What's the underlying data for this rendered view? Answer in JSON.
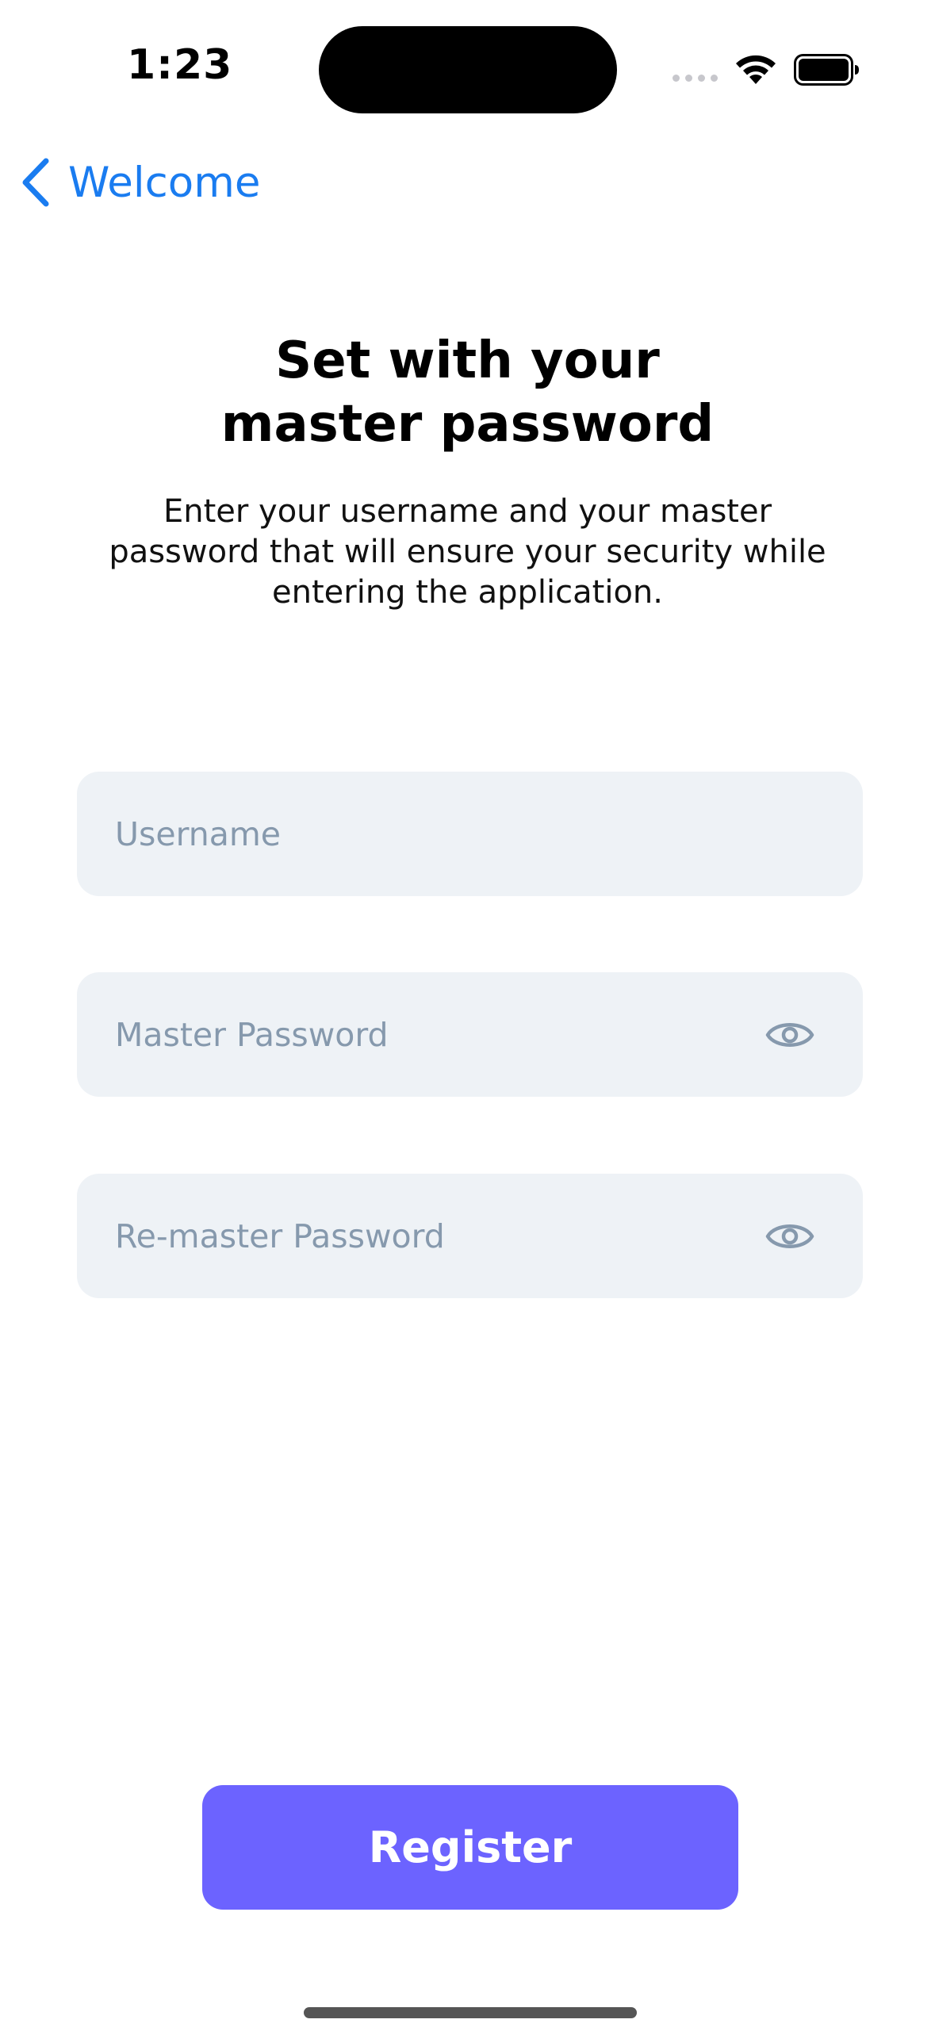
{
  "status_bar": {
    "time": "1:23",
    "icons": [
      "signal-dots-icon",
      "wifi-icon",
      "battery-icon"
    ]
  },
  "nav": {
    "back_label": "Welcome",
    "back_icon": "chevron-left-icon"
  },
  "header": {
    "title": "Set with your\nmaster password",
    "subtitle": "Enter your username and your master password that will ensure your security while entering the application."
  },
  "form": {
    "username_placeholder": "Username",
    "password_placeholder": "Master Password",
    "repassword_placeholder": "Re-master Password",
    "password_toggle_icon": "eye-icon"
  },
  "actions": {
    "register_label": "Register"
  },
  "colors": {
    "accent": "#1a7cf0",
    "button": "#6c63ff",
    "field_bg": "#eef2f6",
    "placeholder": "#8699ad"
  }
}
